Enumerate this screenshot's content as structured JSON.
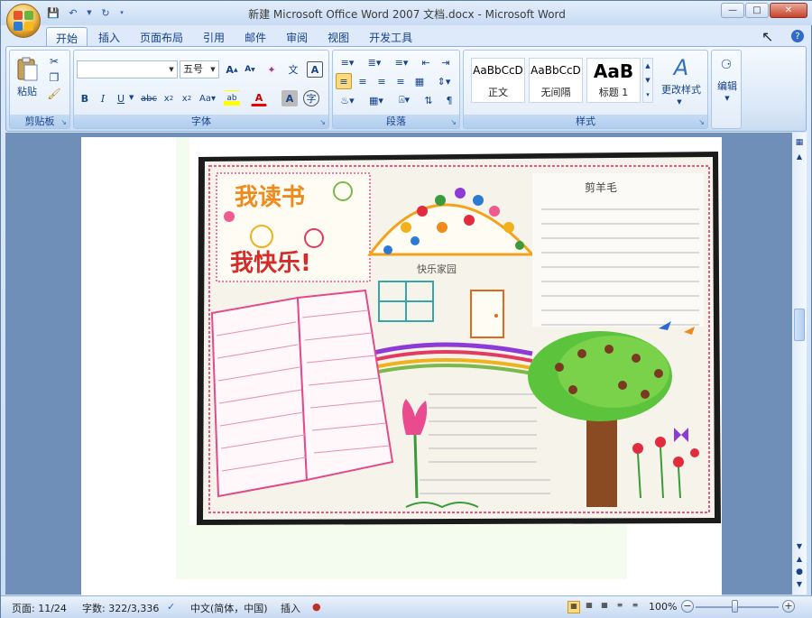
{
  "window": {
    "title": "新建 Microsoft Office Word 2007 文档.docx - Microsoft Word"
  },
  "tabs": [
    "开始",
    "插入",
    "页面布局",
    "引用",
    "邮件",
    "审阅",
    "视图",
    "开发工具"
  ],
  "ribbon": {
    "clipboard": {
      "label": "剪贴板",
      "paste": "粘贴"
    },
    "font": {
      "label": "字体",
      "font_name": "",
      "font_size": "五号"
    },
    "paragraph": {
      "label": "段落"
    },
    "styles": {
      "label": "样式",
      "items": [
        {
          "sample": "AaBbCcD",
          "name": "正文"
        },
        {
          "sample": "AaBbCcD",
          "name": "无间隔"
        },
        {
          "sample": "AaB",
          "name": "标题 1"
        }
      ],
      "change": "更改样式"
    },
    "editing": {
      "label": "编辑"
    }
  },
  "poster": {
    "title1": "我读书",
    "title2": "我快乐!",
    "house_label": "快乐家园",
    "right_title": "剪羊毛"
  },
  "status": {
    "page": "页面: 11/24",
    "words": "字数: 322/3,336",
    "language": "中文(简体，中国)",
    "mode": "插入",
    "zoom": "100%"
  }
}
